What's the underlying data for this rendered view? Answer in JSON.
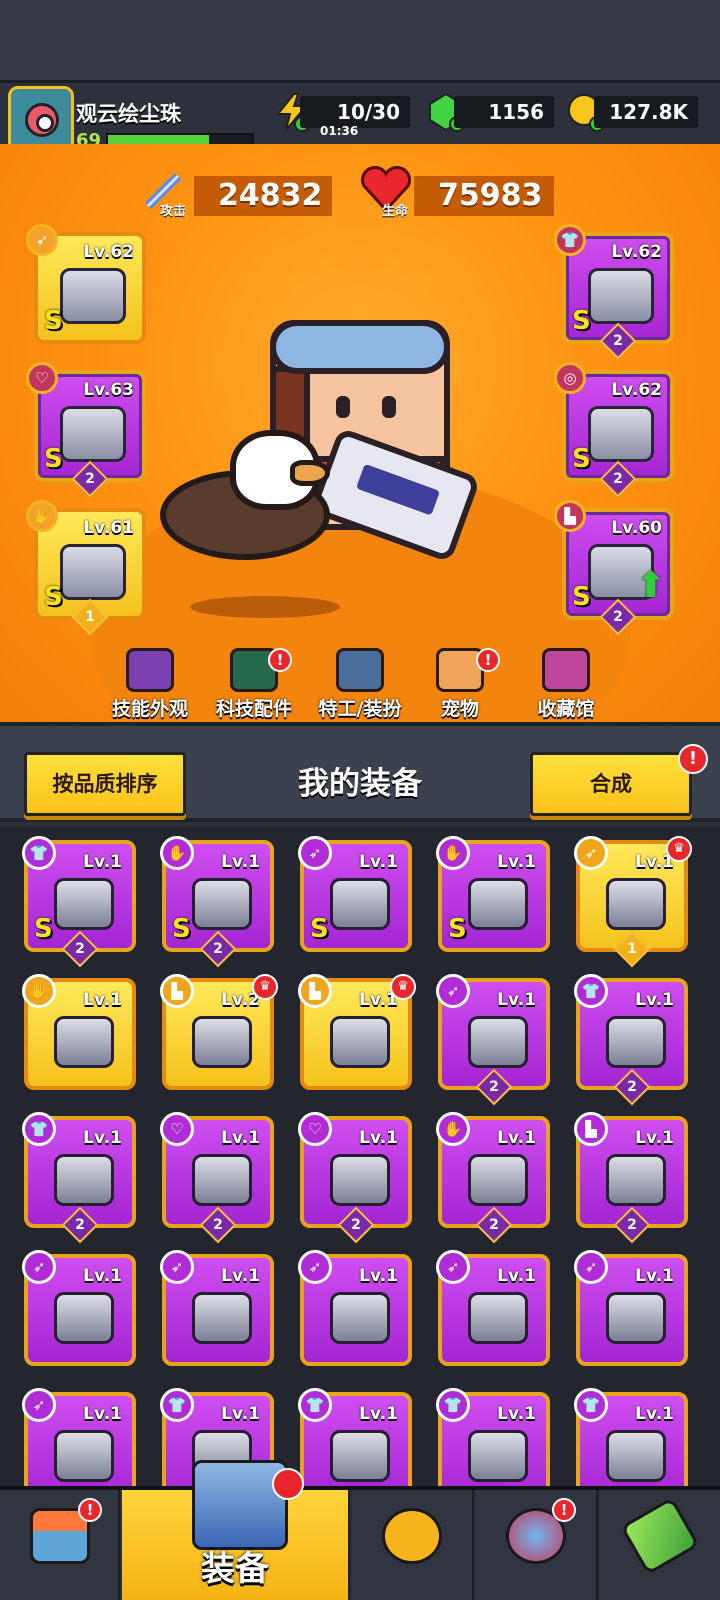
{
  "player": {
    "name": "观云绘尘珠",
    "level": "69",
    "xp_fraction": 0.7
  },
  "resources": {
    "energy": {
      "value": "10/30",
      "timer": "01:36",
      "icon": "lightning-icon"
    },
    "gems": {
      "value": "1156",
      "icon": "green-gem-icon"
    },
    "gold": {
      "value": "127.8K",
      "icon": "gold-coin-icon"
    }
  },
  "stats": {
    "attack": {
      "label": "攻击",
      "value": "24832",
      "icon": "sword-icon"
    },
    "health": {
      "label": "生命",
      "value": "75983",
      "icon": "heart-icon"
    }
  },
  "equipped": {
    "left": [
      {
        "slot": "weapon",
        "level": "Lv.62",
        "grade": "S",
        "rank": "",
        "color": "gold"
      },
      {
        "slot": "necklace",
        "level": "Lv.63",
        "grade": "S",
        "rank": "2",
        "color": "purple"
      },
      {
        "slot": "gloves",
        "level": "Lv.61",
        "grade": "S",
        "rank": "1",
        "color": "gold"
      }
    ],
    "right": [
      {
        "slot": "armor",
        "level": "Lv.62",
        "grade": "S",
        "rank": "2",
        "color": "purple"
      },
      {
        "slot": "belt",
        "level": "Lv.62",
        "grade": "S",
        "rank": "2",
        "color": "purple"
      },
      {
        "slot": "boots",
        "level": "Lv.60",
        "grade": "S",
        "rank": "2",
        "color": "purple",
        "upgrade": true
      }
    ]
  },
  "hero_nav": [
    {
      "label": "技能外观",
      "icon": "skill-skin-icon",
      "badge": ""
    },
    {
      "label": "科技配件",
      "icon": "tech-part-icon",
      "badge": "!"
    },
    {
      "label": "特工/装扮",
      "icon": "agent-icon",
      "badge": ""
    },
    {
      "label": "宠物",
      "icon": "pet-icon",
      "badge": "!"
    },
    {
      "label": "收藏馆",
      "icon": "collection-icon",
      "badge": ""
    }
  ],
  "section": {
    "sort_button": "按品质排序",
    "title": "我的装备",
    "merge_button": "合成",
    "merge_badge": "!"
  },
  "inventory": [
    {
      "level": "Lv.1",
      "grade": "S",
      "rank": "2",
      "color": "purple",
      "slot": "armor"
    },
    {
      "level": "Lv.1",
      "grade": "S",
      "rank": "2",
      "color": "purple",
      "slot": "gloves"
    },
    {
      "level": "Lv.1",
      "grade": "S",
      "rank": "",
      "color": "purple",
      "slot": "weapon"
    },
    {
      "level": "Lv.1",
      "grade": "S",
      "rank": "",
      "color": "purple",
      "slot": "gloves"
    },
    {
      "level": "Lv.1",
      "grade": "",
      "rank": "1",
      "color": "gold",
      "slot": "weapon",
      "new": true
    },
    {
      "level": "Lv.1",
      "grade": "",
      "rank": "",
      "color": "gold",
      "slot": "gloves"
    },
    {
      "level": "Lv.2",
      "grade": "",
      "rank": "",
      "color": "gold",
      "slot": "boots",
      "new": true
    },
    {
      "level": "Lv.1",
      "grade": "",
      "rank": "",
      "color": "gold",
      "slot": "boots",
      "new": true
    },
    {
      "level": "Lv.1",
      "grade": "",
      "rank": "2",
      "color": "purple",
      "slot": "weapon"
    },
    {
      "level": "Lv.1",
      "grade": "",
      "rank": "2",
      "color": "purple",
      "slot": "armor"
    },
    {
      "level": "Lv.1",
      "grade": "",
      "rank": "2",
      "color": "purple",
      "slot": "armor"
    },
    {
      "level": "Lv.1",
      "grade": "",
      "rank": "2",
      "color": "purple",
      "slot": "necklace"
    },
    {
      "level": "Lv.1",
      "grade": "",
      "rank": "2",
      "color": "purple",
      "slot": "necklace"
    },
    {
      "level": "Lv.1",
      "grade": "",
      "rank": "2",
      "color": "purple",
      "slot": "gloves"
    },
    {
      "level": "Lv.1",
      "grade": "",
      "rank": "2",
      "color": "purple",
      "slot": "boots"
    },
    {
      "level": "Lv.1",
      "grade": "",
      "rank": "",
      "color": "purple",
      "slot": "weapon"
    },
    {
      "level": "Lv.1",
      "grade": "",
      "rank": "",
      "color": "purple",
      "slot": "weapon"
    },
    {
      "level": "Lv.1",
      "grade": "",
      "rank": "",
      "color": "purple",
      "slot": "weapon"
    },
    {
      "level": "Lv.1",
      "grade": "",
      "rank": "",
      "color": "purple",
      "slot": "weapon"
    },
    {
      "level": "Lv.1",
      "grade": "",
      "rank": "",
      "color": "purple",
      "slot": "weapon"
    },
    {
      "level": "Lv.1",
      "grade": "",
      "rank": "",
      "color": "purple",
      "slot": "weapon"
    },
    {
      "level": "Lv.1",
      "grade": "",
      "rank": "",
      "color": "purple",
      "slot": "armor"
    },
    {
      "level": "Lv.1",
      "grade": "",
      "rank": "",
      "color": "purple",
      "slot": "armor"
    },
    {
      "level": "Lv.1",
      "grade": "",
      "rank": "",
      "color": "purple",
      "slot": "armor"
    },
    {
      "level": "Lv.1",
      "grade": "",
      "rank": "",
      "color": "purple",
      "slot": "armor"
    }
  ],
  "tabs": [
    {
      "name": "shop",
      "label": "",
      "icon": "shop-icon",
      "badge": "!"
    },
    {
      "name": "equipment",
      "label": "装备",
      "icon": "equipment-icon",
      "badge": "",
      "active": true
    },
    {
      "name": "battle",
      "label": "",
      "icon": "battle-star-icon",
      "badge": ""
    },
    {
      "name": "talent",
      "label": "",
      "icon": "orb-icon",
      "badge": "!"
    },
    {
      "name": "gene",
      "label": "",
      "icon": "gene-icon",
      "badge": ""
    }
  ],
  "colors": {
    "accent_gold": "#f9c21a",
    "rarity_purple": "#b22fe0",
    "hero_orange": "#ff9312",
    "alert_red": "#e8262b"
  }
}
